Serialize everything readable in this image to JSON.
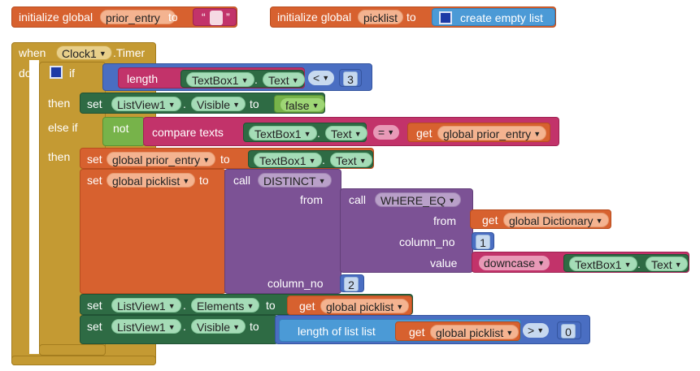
{
  "global_prior_entry": {
    "init": "initialize global",
    "name": "prior_entry",
    "to": "to",
    "quote_open": "“",
    "quote_close": "”"
  },
  "global_picklist": {
    "init": "initialize global",
    "name": "picklist",
    "to": "to",
    "value": "create empty list"
  },
  "event": {
    "when": "when",
    "component": "Clock1",
    "event": ".Timer",
    "do": "do"
  },
  "if_block": {
    "if": "if",
    "then": "then",
    "else_if": "else if",
    "then2": "then"
  },
  "condition1": {
    "length": "length",
    "component": "TextBox1",
    "dot": ".",
    "prop": "Text",
    "op": "<",
    "value": "3"
  },
  "then1": {
    "set": "set",
    "component": "ListView1",
    "dot": ".",
    "prop": "Visible",
    "to": "to",
    "value": "false"
  },
  "condition2": {
    "not": "not",
    "compare": "compare texts",
    "component": "TextBox1",
    "dot": ".",
    "prop": "Text",
    "op": "=",
    "get": "get",
    "var": "global prior_entry"
  },
  "then2_set_prior": {
    "set": "set",
    "var": "global prior_entry",
    "to": "to",
    "component": "TextBox1",
    "dot": ".",
    "prop": "Text"
  },
  "then2_set_picklist": {
    "set": "set",
    "var": "global picklist",
    "to": "to",
    "call": "call",
    "proc": "DISTINCT",
    "from_label": "from",
    "inner_call": "call",
    "inner_proc": "WHERE_EQ",
    "inner_from_label": "from",
    "inner_from_get": "get",
    "inner_from_var": "global Dictionary",
    "inner_colno_label": "column_no",
    "inner_colno_value": "1",
    "inner_value_label": "value",
    "downcase": "downcase",
    "value_component": "TextBox1",
    "value_dot": ".",
    "value_prop": "Text",
    "colno_label": "column_no",
    "colno_value": "2"
  },
  "then2_set_elements": {
    "set": "set",
    "component": "ListView1",
    "dot": ".",
    "prop": "Elements",
    "to": "to",
    "get": "get",
    "var": "global picklist"
  },
  "then2_set_visible": {
    "set": "set",
    "component": "ListView1",
    "dot": ".",
    "prop": "Visible",
    "to": "to",
    "length_of_list": "length of list  list",
    "get": "get",
    "var": "global picklist",
    "op": ">",
    "value": "0"
  },
  "colors": {
    "control": "#c49a33",
    "variables": "#d7612f",
    "components": "#2e6b44",
    "logic": "#77b34a",
    "math": "#4a6ec2",
    "lists": "#4b9ad6",
    "text": "#c2336a",
    "procedures": "#7c5295"
  }
}
